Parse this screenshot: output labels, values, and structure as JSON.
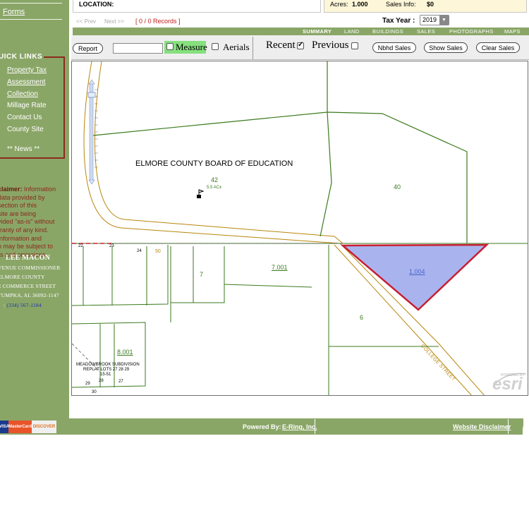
{
  "sidebar": {
    "forms_link": "Forms",
    "quick_links_title": "UICK LINKS",
    "quick_links": [
      {
        "label": "Property Tax",
        "underlined": true
      },
      {
        "label": "Assessment",
        "underlined": true
      },
      {
        "label": "Collection",
        "underlined": true
      },
      {
        "label": "Millage Rate",
        "underlined": false
      },
      {
        "label": "Contact Us",
        "underlined": false
      },
      {
        "label": "County Site",
        "underlined": false
      }
    ],
    "news": "** News **",
    "disclaimer_label": "claimer:",
    "disclaimer_lines": [
      "Information",
      " data provided by",
      " section of this",
      "site are being",
      "vided \"as-is\" without",
      "rranty of any kind.",
      " information and",
      "n may be subject to",
      "rs and omissions."
    ],
    "commissioner_name": "LEE MACON",
    "address_lines": [
      "VENUE COMMISSIONER",
      " ELMORE COUNTY",
      "E COMMERCE STREET",
      "TUMPKA, AL 36092-1147"
    ],
    "phone_prefix": ": ",
    "phone": "(334) 567-1184"
  },
  "header": {
    "location_label": "LOCATION:",
    "acres_label": "Acres:",
    "acres_value": "1.000",
    "sales_info_label": "Sales Info:",
    "sales_info_value": "$0",
    "prev": "<< Prev",
    "next": "Next >>",
    "records": "[ 0 / 0 Records ]",
    "tax_year_label": "Tax Year :",
    "tax_year_value": "2019"
  },
  "tabs": [
    "SUMMARY",
    "LAND",
    "BUILDINGS",
    "SALES",
    "PHOTOGRAPHS",
    "MAPS"
  ],
  "toolbar": {
    "report": "Report",
    "search_value": "",
    "measure": "Measure",
    "aerials": "Aerials",
    "recent": "Recent",
    "previous": "Previous",
    "nbhd_sales": "Nbhd Sales",
    "show_sales": "Show Sales",
    "clear_sales": "Clear Sales"
  },
  "map": {
    "labels": [
      {
        "text": "ELMORE COUNTY BOARD OF EDUCATION",
        "kind": "owner"
      },
      {
        "text": "42",
        "kind": "parcel"
      },
      {
        "text": "5.5 AC±",
        "kind": "small"
      },
      {
        "text": "40",
        "kind": "parcel"
      },
      {
        "text": "7.001",
        "kind": "parcel"
      },
      {
        "text": "7",
        "kind": "parcel"
      },
      {
        "text": "1.004",
        "kind": "selected"
      },
      {
        "text": "6",
        "kind": "parcel"
      },
      {
        "text": "8.001",
        "kind": "parcel"
      },
      {
        "text": "COLLEGE STREET",
        "kind": "street"
      },
      {
        "text": "MEADOWBROOK SUBDIVISION",
        "kind": "subdivision"
      },
      {
        "text": "REPLAT LOTS 27 28 29",
        "kind": "subdivision"
      },
      {
        "text": "15-51",
        "kind": "subdivision"
      },
      {
        "text": "22",
        "kind": "lot"
      },
      {
        "text": "23",
        "kind": "lot"
      },
      {
        "text": "24",
        "kind": "lot"
      },
      {
        "text": "28",
        "kind": "lot"
      },
      {
        "text": "27",
        "kind": "lot"
      },
      {
        "text": "29",
        "kind": "lot"
      },
      {
        "text": "30",
        "kind": "lot"
      },
      {
        "text": "50",
        "kind": "lot"
      }
    ],
    "watermark": "esri",
    "watermark_small": "POWERED BY"
  },
  "footer": {
    "cards": [
      "VISA",
      "MasterCard",
      "DISCOVER"
    ],
    "powered_by": "Powered By:",
    "powered_link": "E-Ring, Inc.",
    "disclaimer_link": "Website Disclaimer"
  },
  "colors": {
    "sidebar_green": "#8aa667",
    "parcel_line": "#3b7a1e",
    "road_edge": "#b8860b",
    "selected_fill": "#a9b4ee",
    "selected_border": "#c81e32",
    "disclaimer_red": "#8b2a1c",
    "measure_highlight": "#86e07e"
  }
}
